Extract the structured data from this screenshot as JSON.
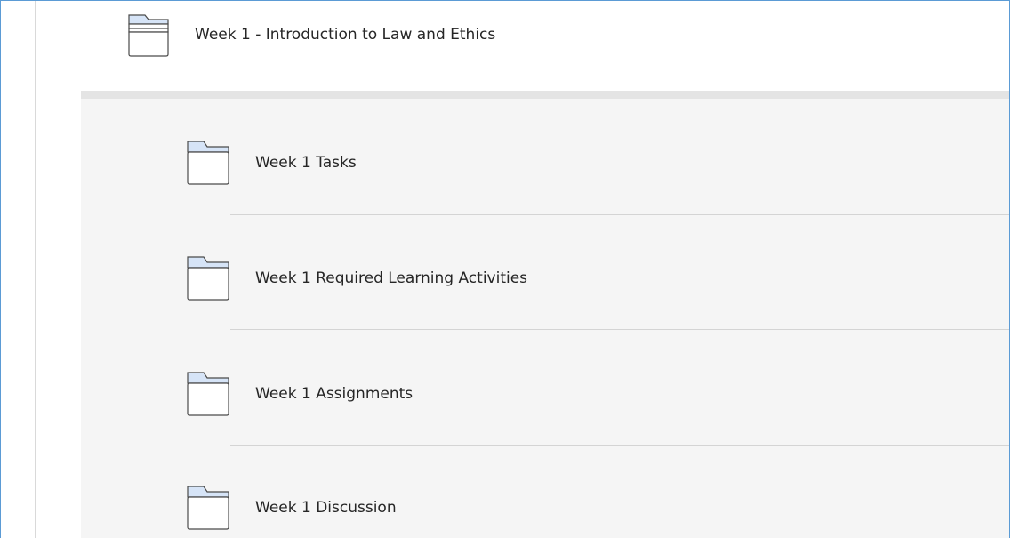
{
  "parent": {
    "title": "Week 1 - Introduction to Law and Ethics",
    "icon": "folder-open-icon"
  },
  "items": [
    {
      "label": "Week 1 Tasks",
      "icon": "folder-icon"
    },
    {
      "label": "Week 1 Required Learning Activities",
      "icon": "folder-icon"
    },
    {
      "label": "Week 1 Assignments",
      "icon": "folder-icon"
    },
    {
      "label": "Week 1 Discussion",
      "icon": "folder-icon"
    }
  ],
  "colors": {
    "frame_border": "#5b9bd5",
    "folder_tab": "#d6e4f7",
    "panel_background": "#f5f5f5"
  }
}
